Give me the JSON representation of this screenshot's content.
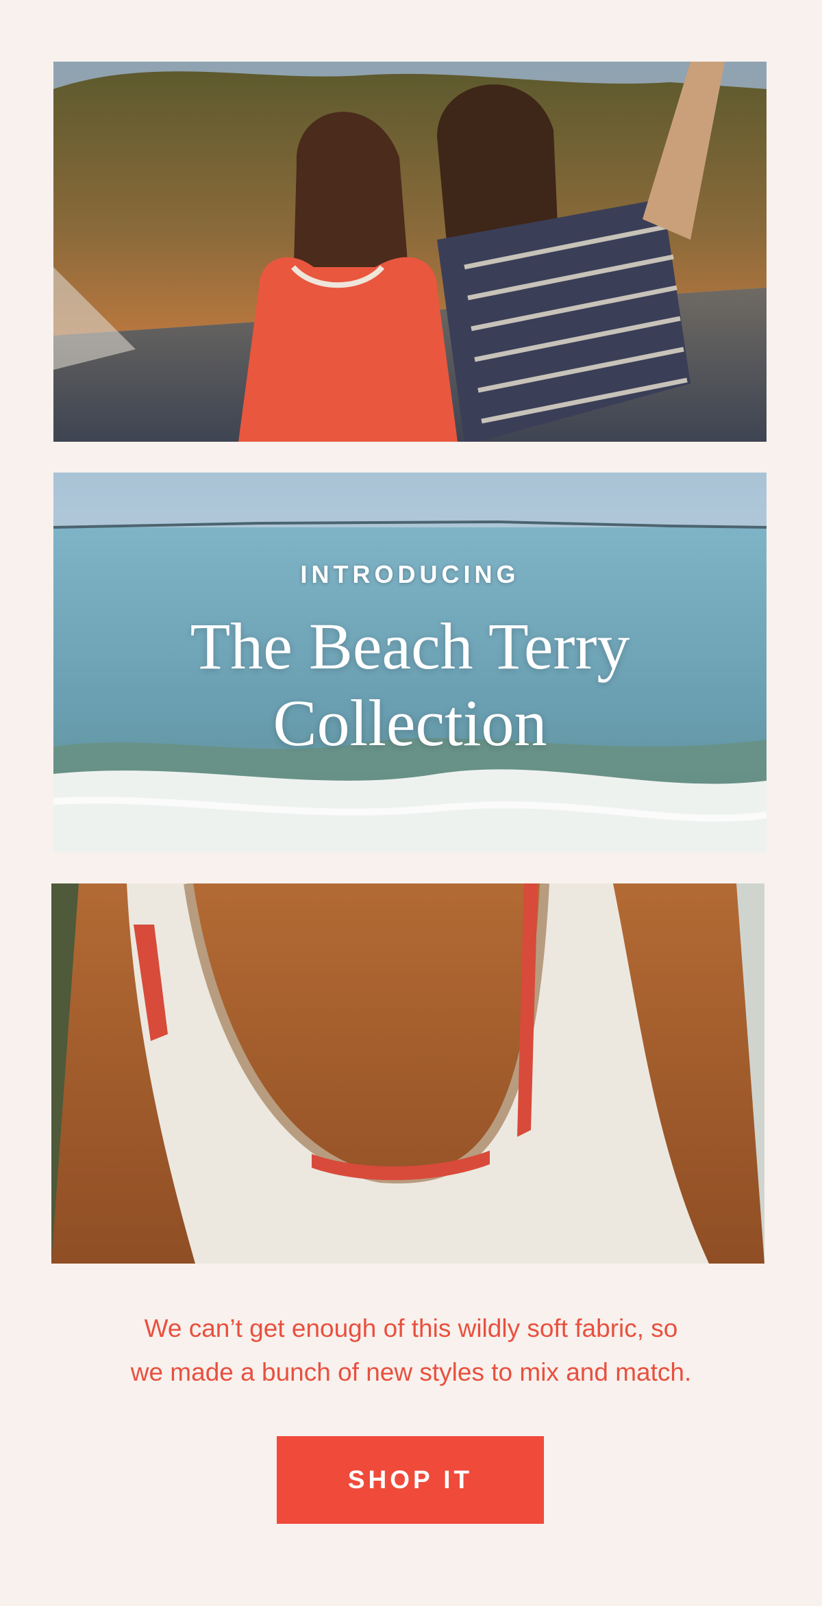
{
  "hero": {
    "eyebrow": "INTRODUCING",
    "headline_line1": "The Beach Terry",
    "headline_line2": "Collection"
  },
  "body": {
    "line1": "We can’t get enough of this wildly soft fabric, so",
    "line2": "we made a bunch of new styles to mix and match."
  },
  "cta": {
    "label": "SHOP IT"
  },
  "colors": {
    "background": "#f8f1ed",
    "accent": "#f04a3b",
    "text_accent": "#e8503f",
    "hero_text": "#ffffff"
  }
}
